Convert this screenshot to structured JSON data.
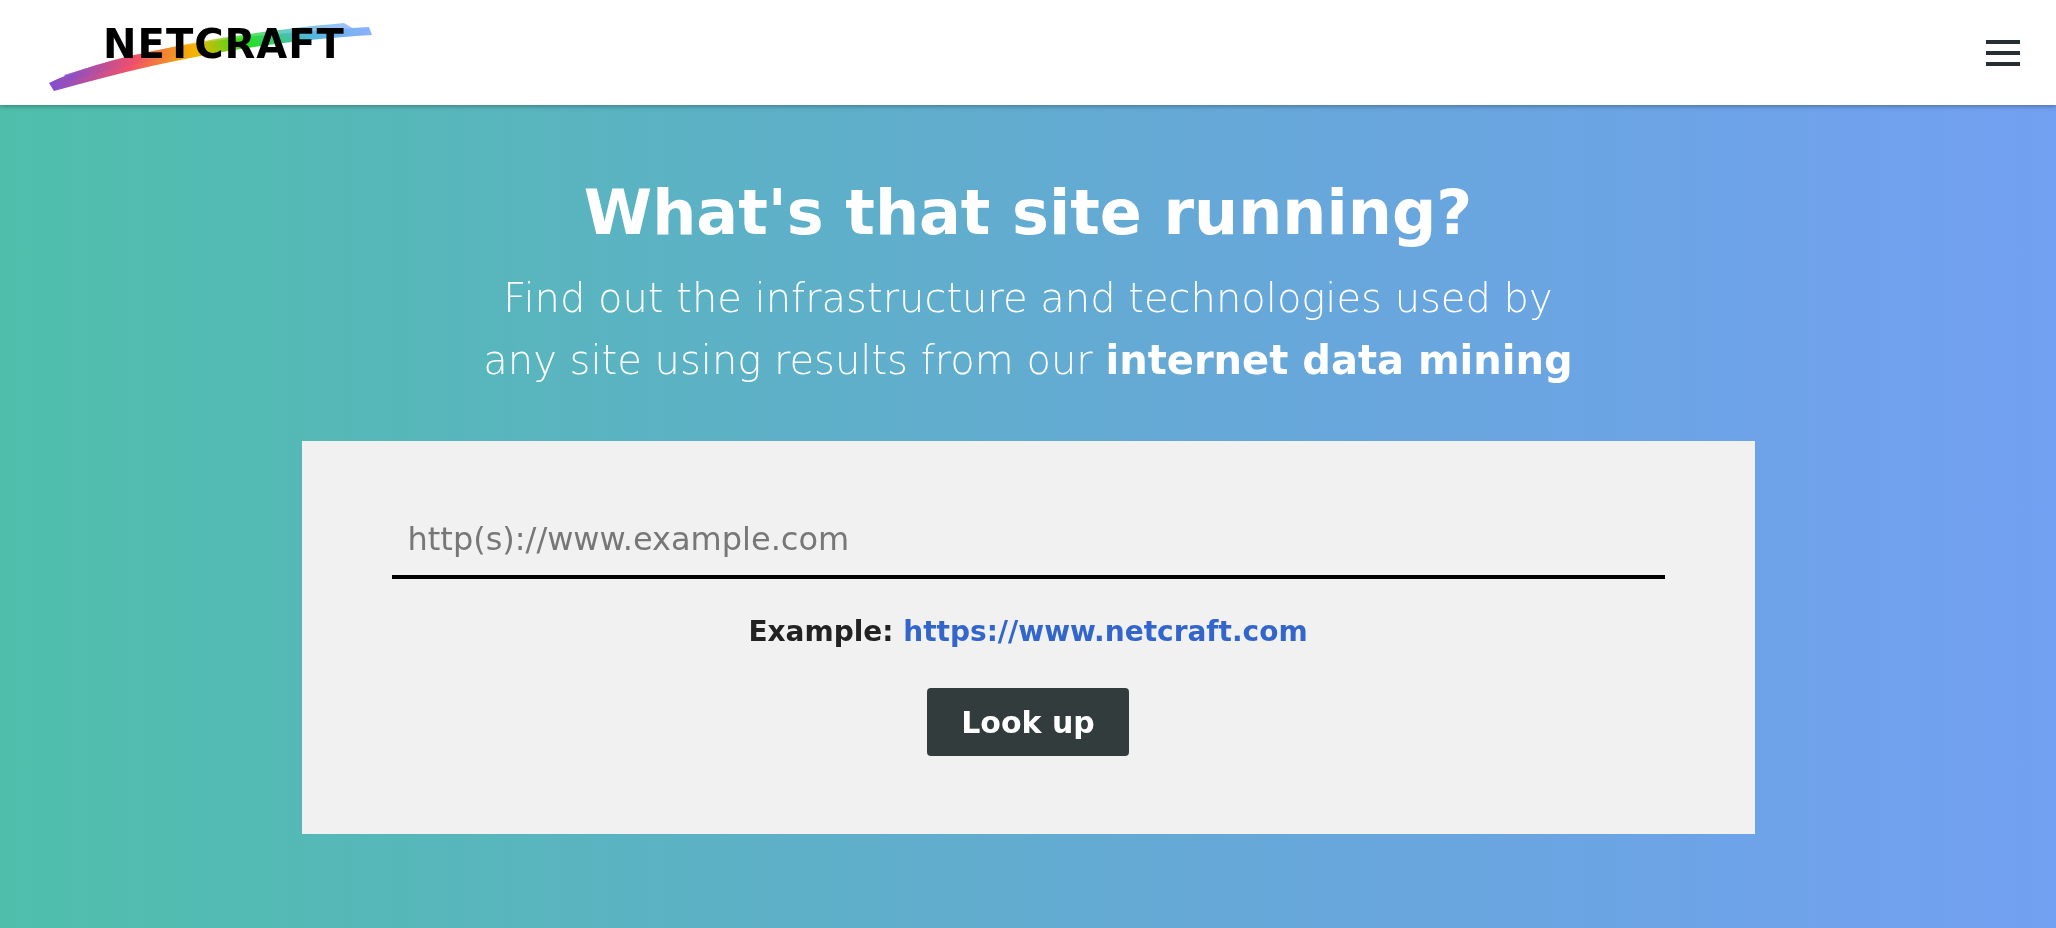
{
  "header": {
    "logo": "NETCRAFT"
  },
  "hero": {
    "title": "What's that site running?",
    "subtitle": "Find out the infrastructure and technologies used by\nany site using results from our **internet data mining**"
  },
  "lookup": {
    "placeholder": "http(s)://www.example.com",
    "example_label": "Example:",
    "example_link": "https://www.netcraft.com",
    "button": "Look up"
  }
}
